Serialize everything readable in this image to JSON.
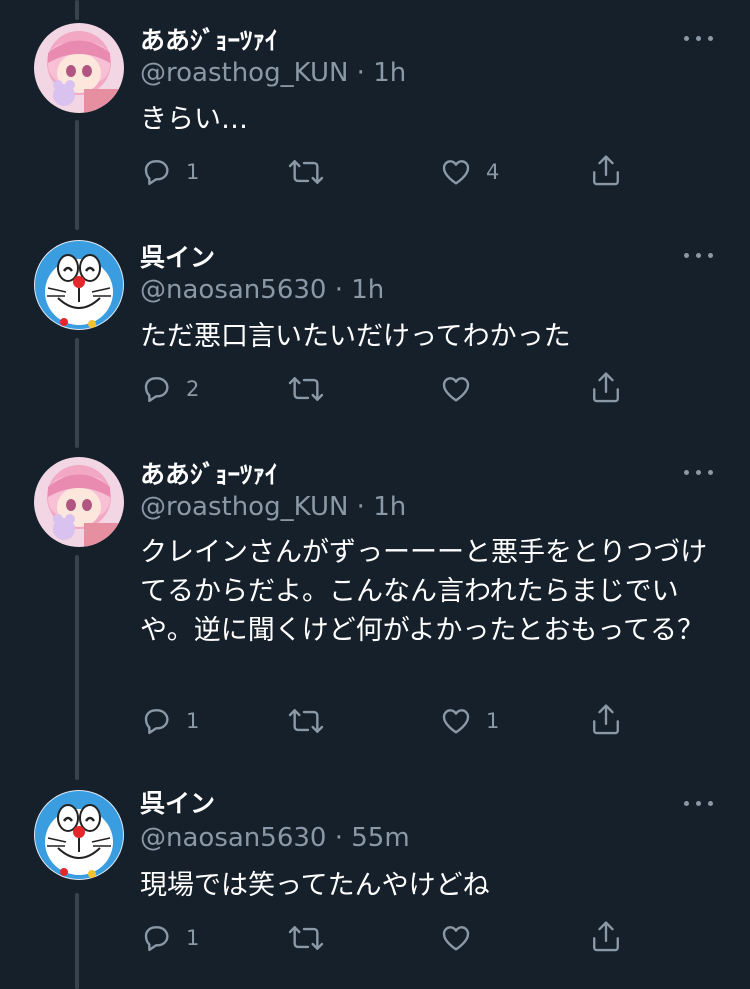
{
  "tweets": [
    {
      "name": "ああｼﾞｮｰﾂｧｲ",
      "handle": "@roasthog_KUN",
      "time": "1h",
      "handle_time": "@roasthog_KUN · 1h",
      "text": "きらい…",
      "replies": "1",
      "retweets": "",
      "likes": "4",
      "avatar": "anime-girl-avatar"
    },
    {
      "name": "呉イン",
      "handle": "@naosan5630",
      "time": "1h",
      "handle_time": "@naosan5630 · 1h",
      "text": "ただ悪口言いたいだけってわかった",
      "replies": "2",
      "retweets": "",
      "likes": "",
      "avatar": "doraemon-avatar"
    },
    {
      "name": "ああｼﾞｮｰﾂｧｲ",
      "handle": "@roasthog_KUN",
      "time": "1h",
      "handle_time": "@roasthog_KUN · 1h",
      "text": "クレインさんがずっーーーと悪手をとりつづけてるからだよ。こんなん言われたらまじでいや。逆に聞くけど何がよかったとおもってる？",
      "replies": "1",
      "retweets": "",
      "likes": "1",
      "avatar": "anime-girl-avatar"
    },
    {
      "name": "呉イン",
      "handle": "@naosan5630",
      "time": "55m",
      "handle_time": "@naosan5630 · 55m",
      "text": "現場では笑ってたんやけどね",
      "replies": "1",
      "retweets": "",
      "likes": "",
      "avatar": "doraemon-avatar"
    }
  ],
  "icons": {
    "reply": "reply-icon",
    "retweet": "retweet-icon",
    "like": "like-icon",
    "share": "share-icon",
    "more": "more-icon"
  },
  "colors": {
    "background": "#15202b",
    "secondary_text": "#8b98a5",
    "thread_line": "#38444d"
  }
}
